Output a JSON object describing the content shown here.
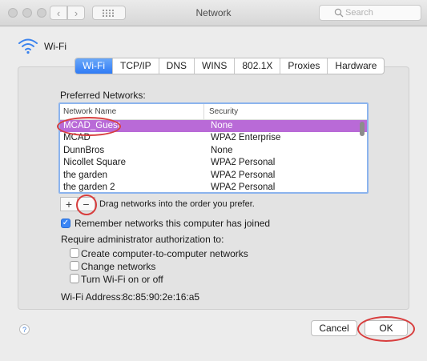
{
  "window": {
    "title": "Network"
  },
  "search": {
    "placeholder": "Search"
  },
  "header": {
    "interface_label": "Wi-Fi"
  },
  "tabs": [
    {
      "label": "Wi-Fi",
      "active": true
    },
    {
      "label": "TCP/IP"
    },
    {
      "label": "DNS"
    },
    {
      "label": "WINS"
    },
    {
      "label": "802.1X"
    },
    {
      "label": "Proxies"
    },
    {
      "label": "Hardware"
    }
  ],
  "preferred": {
    "label": "Preferred Networks:",
    "columns": [
      "Network Name",
      "Security"
    ],
    "rows": [
      {
        "name": "MCAD_Guest",
        "security": "None",
        "selected": true
      },
      {
        "name": "MCAD",
        "security": "WPA2 Enterprise"
      },
      {
        "name": "DunnBros",
        "security": "None"
      },
      {
        "name": "Nicollet Square",
        "security": "WPA2 Personal"
      },
      {
        "name": "the garden",
        "security": "WPA2 Personal"
      },
      {
        "name": "the garden 2",
        "security": "WPA2 Personal"
      }
    ],
    "add_symbol": "+",
    "remove_symbol": "−",
    "drag_hint": "Drag networks into the order you prefer."
  },
  "remember": {
    "label": "Remember networks this computer has joined",
    "checked": true
  },
  "admin": {
    "label": "Require administrator authorization to:",
    "options": [
      {
        "label": "Create computer-to-computer networks",
        "checked": false
      },
      {
        "label": "Change networks",
        "checked": false
      },
      {
        "label": "Turn Wi-Fi on or off",
        "checked": false
      }
    ]
  },
  "address": {
    "label": "Wi-Fi Address:",
    "value": "8c:85:90:2e:16:a5"
  },
  "buttons": {
    "help": "?",
    "cancel": "Cancel",
    "ok": "OK"
  },
  "colors": {
    "accent": "#2f7bf5",
    "selection": "#b96ad7",
    "annotation": "#d83e3e"
  }
}
